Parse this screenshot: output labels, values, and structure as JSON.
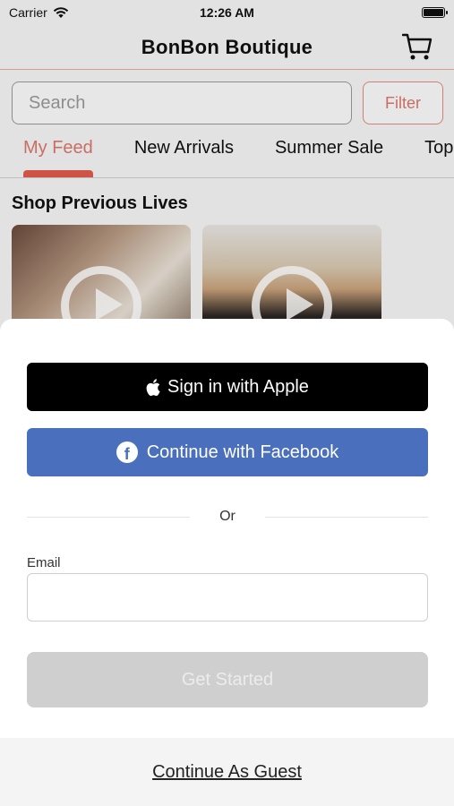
{
  "status_bar": {
    "carrier": "Carrier",
    "time": "12:26 AM"
  },
  "nav": {
    "title": "BonBon Boutique"
  },
  "search": {
    "placeholder": "Search",
    "filter_label": "Filter"
  },
  "tabs": [
    {
      "label": "My Feed",
      "active": true
    },
    {
      "label": "New Arrivals",
      "active": false
    },
    {
      "label": "Summer Sale",
      "active": false
    },
    {
      "label": "Tops",
      "active": false
    }
  ],
  "section": {
    "title": "Shop Previous Lives"
  },
  "sheet": {
    "apple_label": "Sign in with Apple",
    "facebook_label": "Continue with Facebook",
    "or_label": "Or",
    "email_label": "Email",
    "email_value": "",
    "get_started_label": "Get Started",
    "guest_label": "Continue As Guest"
  },
  "colors": {
    "accent": "#d9786c",
    "tab_indicator": "#e25c4c",
    "facebook": "#4a6fbd",
    "apple": "#000000",
    "disabled_button": "#cfcfcf"
  }
}
